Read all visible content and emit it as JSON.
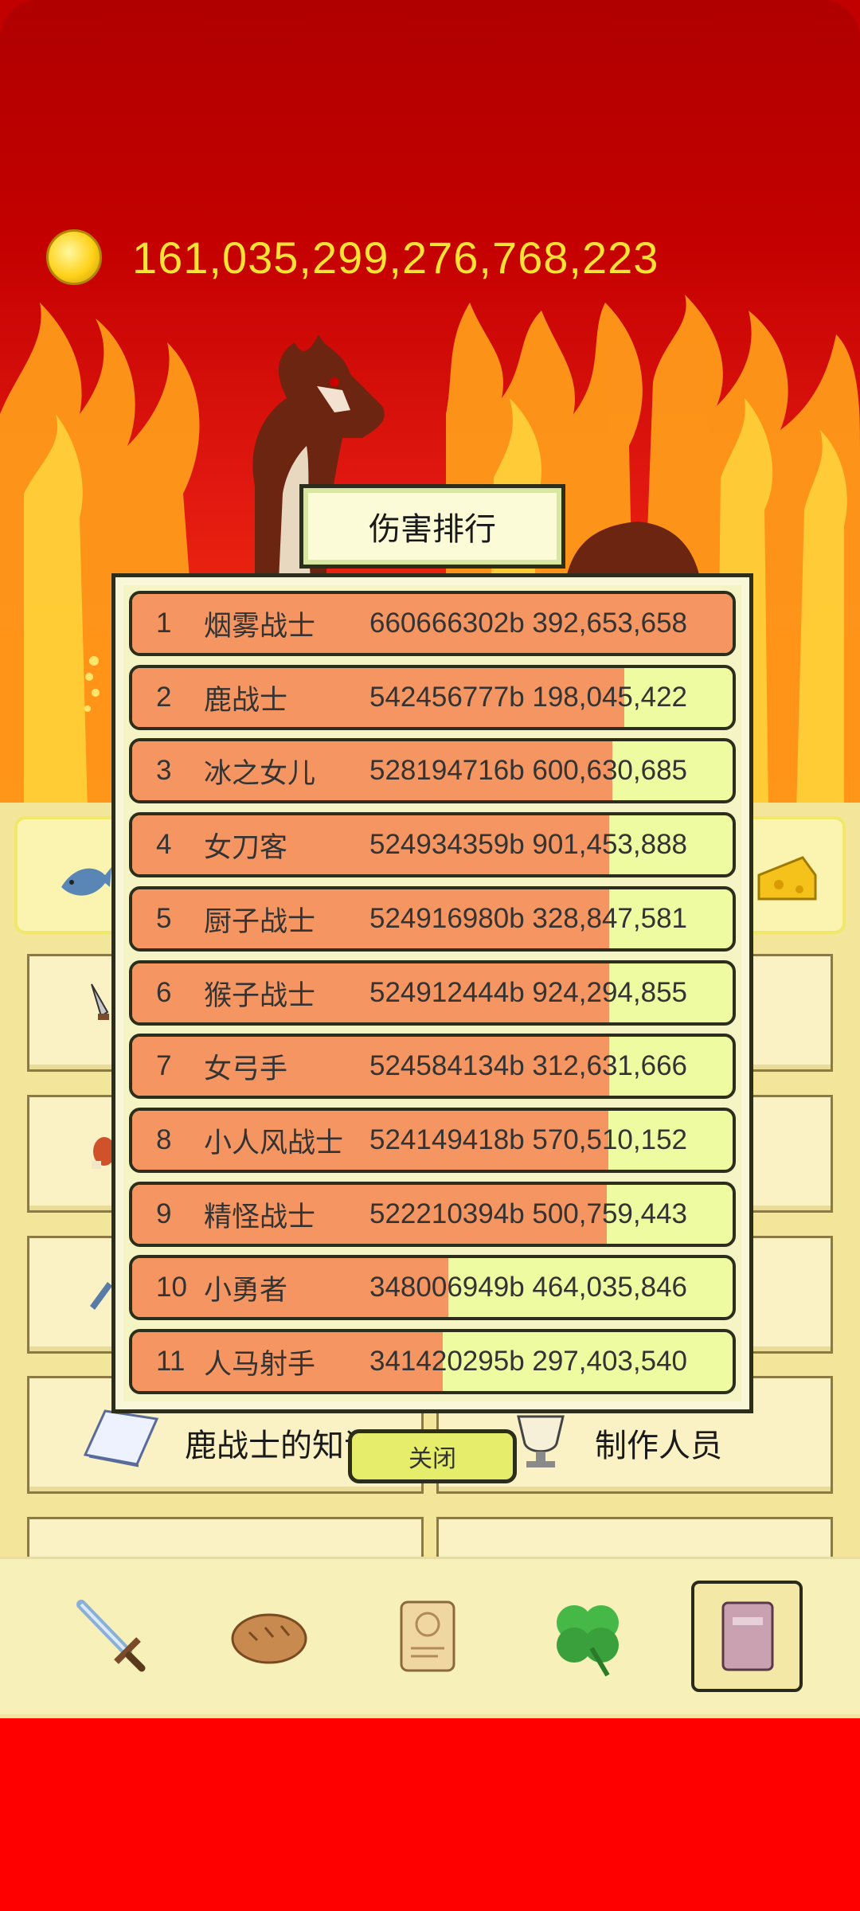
{
  "currency": {
    "icon": "gold-coin-icon",
    "amount": "161,035,299,276,768,223"
  },
  "dialog": {
    "title": "伤害排行",
    "close_label": "关闭",
    "rows": [
      {
        "rank": "1",
        "name": "烟雾战士",
        "score": "660666302b 392,653,658",
        "ratio": 1.0
      },
      {
        "rank": "2",
        "name": "鹿战士",
        "score": "542456777b 198,045,422",
        "ratio": 0.82
      },
      {
        "rank": "3",
        "name": "冰之女儿",
        "score": "528194716b 600,630,685",
        "ratio": 0.8
      },
      {
        "rank": "4",
        "name": "女刀客",
        "score": "524934359b 901,453,888",
        "ratio": 0.795
      },
      {
        "rank": "5",
        "name": "厨子战士",
        "score": "524916980b 328,847,581",
        "ratio": 0.795
      },
      {
        "rank": "6",
        "name": "猴子战士",
        "score": "524912444b 924,294,855",
        "ratio": 0.795
      },
      {
        "rank": "7",
        "name": "女弓手",
        "score": "524584134b 312,631,666",
        "ratio": 0.794
      },
      {
        "rank": "8",
        "name": "小人风战士",
        "score": "524149418b 570,510,152",
        "ratio": 0.793
      },
      {
        "rank": "9",
        "name": "精怪战士",
        "score": "522210394b 500,759,443",
        "ratio": 0.79
      },
      {
        "rank": "10",
        "name": "小勇者",
        "score": "348006949b 464,035,846",
        "ratio": 0.527
      },
      {
        "rank": "11",
        "name": "人马射手",
        "score": "341420295b 297,403,540",
        "ratio": 0.517
      }
    ]
  },
  "menu": {
    "knowledge_label": "鹿战士的知识",
    "credits_label": "制作人员"
  },
  "nav": [
    {
      "icon": "sword-icon"
    },
    {
      "icon": "bread-icon"
    },
    {
      "icon": "scroll-icon"
    },
    {
      "icon": "clover-icon"
    },
    {
      "icon": "book-icon",
      "active": true
    }
  ]
}
